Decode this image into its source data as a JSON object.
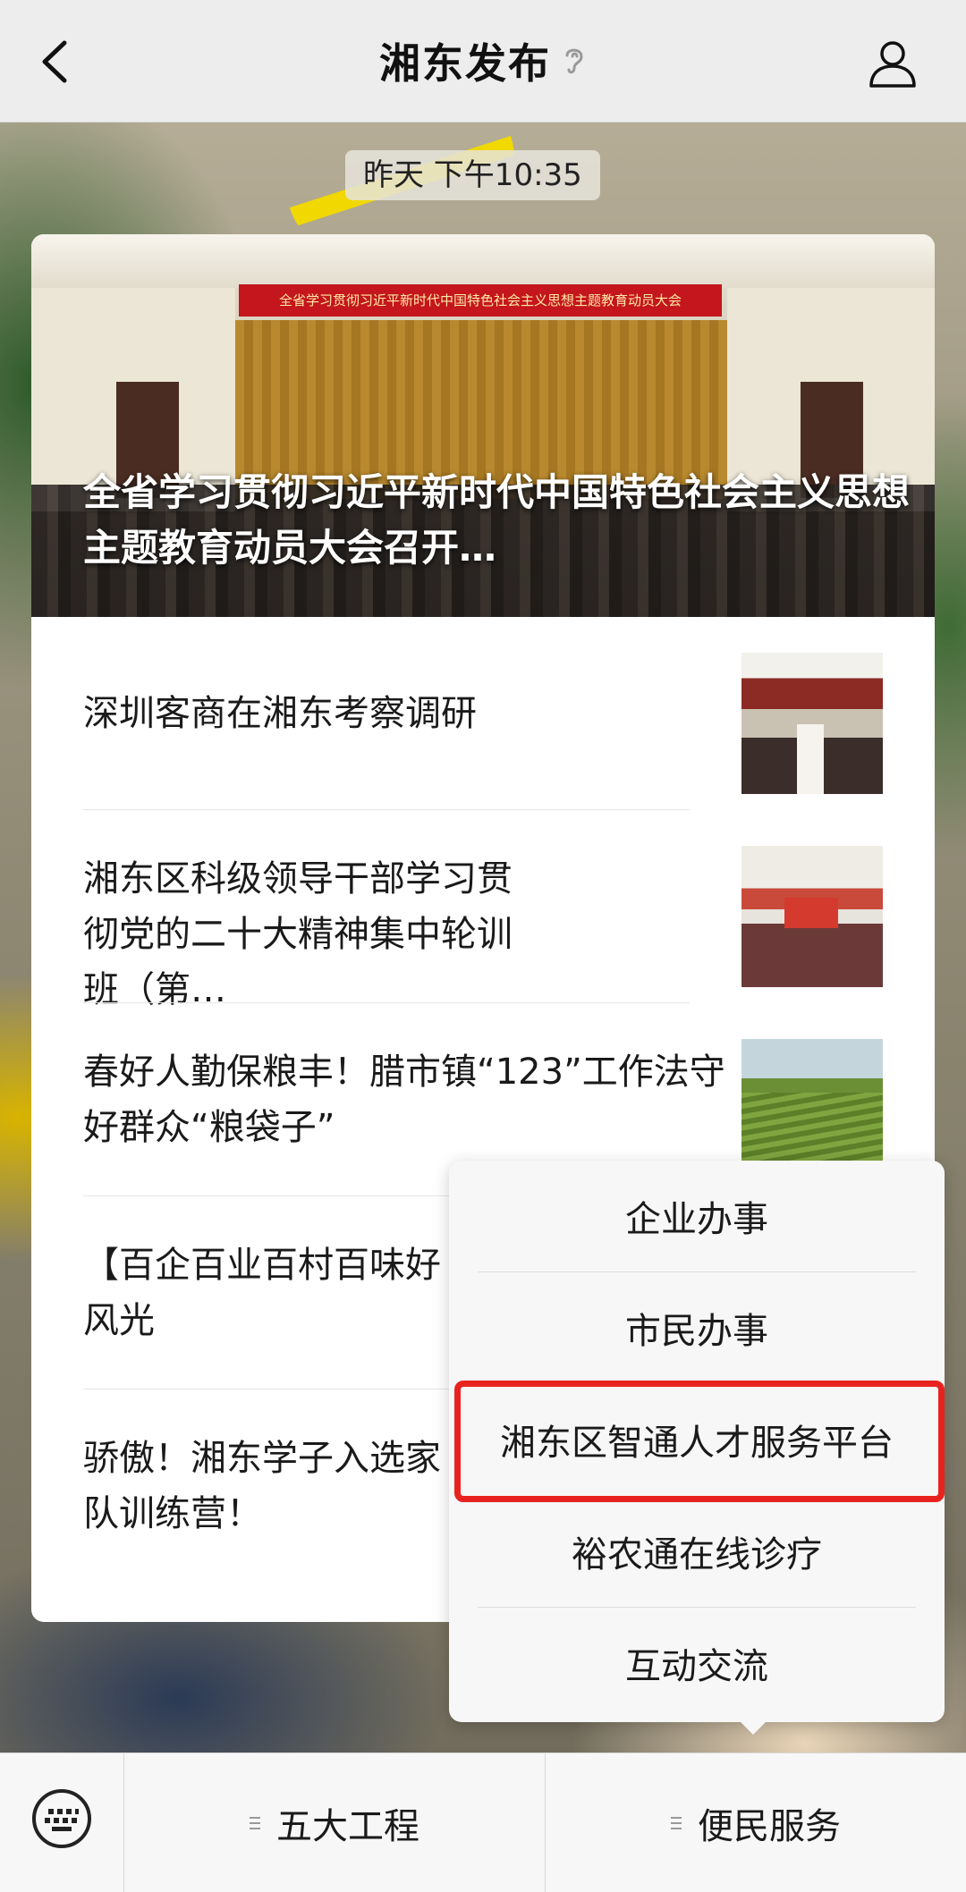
{
  "header": {
    "title": "湘东发布"
  },
  "chat": {
    "timestamp": "昨天 下午10:35"
  },
  "article": {
    "hero_banner": "全省学习贯彻习近平新时代中国特色社会主义思想主题教育动员大会",
    "hero_title": "全省学习贯彻习近平新时代中国特色社会主义思想主题教育动员大会召开…",
    "items": [
      {
        "title": "深圳客商在湘东考察调研"
      },
      {
        "title": "湘东区科级领导干部学习贯彻党的二十大精神集中轮训班（第…"
      },
      {
        "title": "春好人勤保粮丰！腊市镇“123”工作法守好群众“粮袋子”"
      },
      {
        "title": "【百企百业百村百味好风光"
      },
      {
        "title": "骄傲！湘东学子入选家队训练营！"
      }
    ]
  },
  "menu": {
    "items": [
      {
        "label": "企业办事"
      },
      {
        "label": "市民办事"
      },
      {
        "label": "湘东区智通人才服务平台"
      },
      {
        "label": "裕农通在线诊疗"
      },
      {
        "label": "互动交流"
      }
    ],
    "highlighted_index": 2,
    "highlight_color": "#e8231f"
  },
  "bottom_bar": {
    "tabs": [
      {
        "label": "五大工程"
      },
      {
        "label": "便民服务"
      }
    ]
  }
}
